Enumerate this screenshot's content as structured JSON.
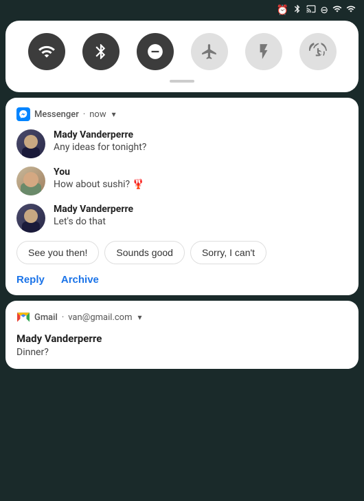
{
  "statusBar": {
    "icons": [
      "alarm",
      "bluetooth",
      "cast",
      "minus-circle",
      "wifi-full",
      "signal-full"
    ]
  },
  "quickSettings": {
    "buttons": [
      {
        "id": "wifi",
        "label": "WiFi",
        "active": true,
        "icon": "wifi"
      },
      {
        "id": "bluetooth",
        "label": "Bluetooth",
        "active": true,
        "icon": "bluetooth"
      },
      {
        "id": "dnd",
        "label": "Do Not Disturb",
        "active": true,
        "icon": "minus"
      },
      {
        "id": "airplane",
        "label": "Airplane Mode",
        "active": false,
        "icon": "airplane"
      },
      {
        "id": "flashlight",
        "label": "Flashlight",
        "active": false,
        "icon": "flashlight"
      },
      {
        "id": "rotate",
        "label": "Auto Rotate",
        "active": false,
        "icon": "rotate"
      }
    ]
  },
  "messengerNotification": {
    "appName": "Messenger",
    "time": "now",
    "messages": [
      {
        "sender": "Mady Vanderperre",
        "text": "Any ideas for tonight?",
        "avatarType": "mady"
      },
      {
        "sender": "You",
        "text": "How about sushi? 🦞",
        "avatarType": "you"
      },
      {
        "sender": "Mady Vanderperre",
        "text": "Let's do that",
        "avatarType": "mady"
      }
    ],
    "quickReplies": [
      "See you then!",
      "Sounds good",
      "Sorry, I can't"
    ],
    "actions": [
      "Reply",
      "Archive"
    ]
  },
  "gmailNotification": {
    "appName": "Gmail",
    "account": "van@gmail.com",
    "sender": "Mady Vanderperre",
    "subject": "Dinner?"
  }
}
